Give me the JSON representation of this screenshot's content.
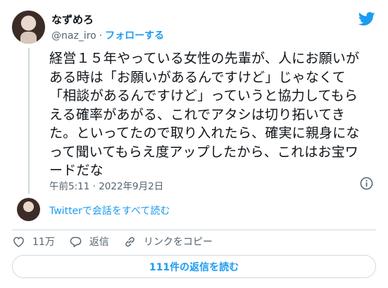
{
  "author": {
    "display_name": "なずめろ",
    "handle": "@naz_iro",
    "separator": "·",
    "follow_label": "フォローする"
  },
  "tweet": {
    "text": "経営１５年やっている女性の先輩が、人にお願いが\nある時は「お願いがあるんですけど」じゃなくて\n「相談があるんですけど」っていうと協力してもら\nえる確率があがる、これでアタシは切り拓いてき\nた。といってたので取り入れたら、確実に親身にな\nって聞いてもらえ度アップしたから、これはお宝ワ\nードだな",
    "timestamp": "午前5:11 · 2022年9月2日"
  },
  "conversation_link": "Twitterで会話をすべて読む",
  "actions": {
    "like_count": "11万",
    "reply_label": "返信",
    "copy_link_label": "リンクをコピー"
  },
  "read_replies_label": "111件の返信を読む",
  "colors": {
    "accent": "#1d9bf0",
    "text": "#0f1419",
    "secondary": "#536471",
    "border": "#cfd9de"
  },
  "icons": [
    "twitter-bird-icon",
    "info-icon",
    "heart-icon",
    "reply-icon",
    "link-icon"
  ]
}
